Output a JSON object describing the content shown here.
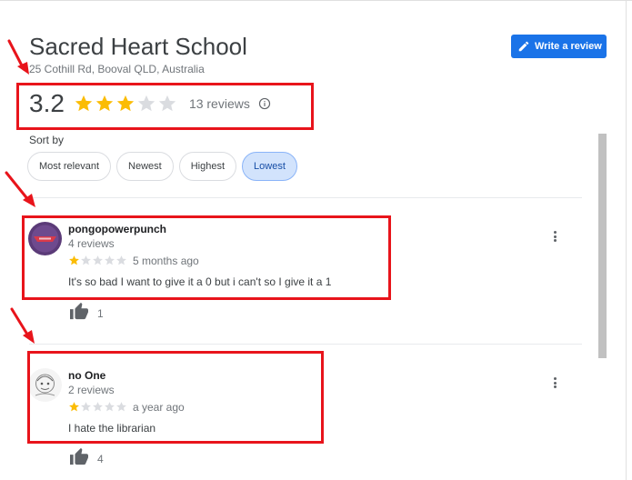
{
  "place": {
    "name": "Sacred Heart School",
    "address": "25 Cothill Rd, Booval QLD, Australia"
  },
  "write_review_label": "Write a review",
  "rating": {
    "value": "3.2",
    "stars": 3,
    "max_stars": 5,
    "reviews_label": "13 reviews"
  },
  "sort": {
    "label": "Sort by",
    "options": [
      "Most relevant",
      "Newest",
      "Highest",
      "Lowest"
    ],
    "selected": "Lowest"
  },
  "reviews": [
    {
      "name": "pongopowerpunch",
      "count": "4 reviews",
      "stars": 1,
      "time": "5 months ago",
      "text": "It's so bad I want to give it a 0 but i can't so I give it a 1",
      "likes": "1"
    },
    {
      "name": "no One",
      "count": "2 reviews",
      "stars": 1,
      "time": "a year ago",
      "text": "I hate the librarian",
      "likes": "4"
    }
  ],
  "colors": {
    "accent": "#1a73e8",
    "star_filled": "#fbbc04",
    "star_empty": "#dadce0",
    "highlight": "#e8141b",
    "chip_selected_bg": "#d2e3fc"
  },
  "icons": [
    "pencil-icon",
    "star-icon",
    "info-icon",
    "thumbs-up-icon",
    "more-vert-icon",
    "red-arrow-annotation"
  ]
}
